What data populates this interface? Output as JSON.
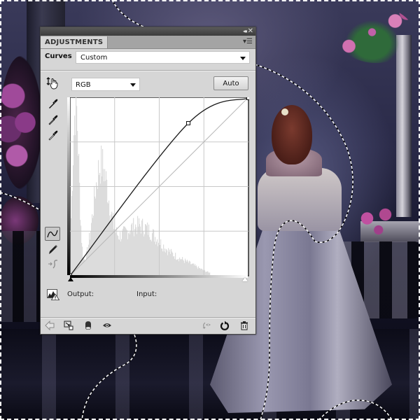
{
  "panel": {
    "tab_label": "ADJUSTMENTS",
    "collapse_glyph": "◂◂",
    "close_glyph": "✕",
    "menu_glyph": "▾☰",
    "adjustment_name": "Curves",
    "preset_value": "Custom",
    "channel_value": "RGB",
    "auto_label": "Auto",
    "output_label": "Output:",
    "input_label": "Input:"
  },
  "curves": {
    "channel": "RGB",
    "range": [
      0,
      255
    ],
    "grid_divisions": 4,
    "control_points": [
      [
        0,
        0
      ],
      [
        169,
        218
      ],
      [
        255,
        254
      ]
    ],
    "baseline": [
      [
        0,
        0
      ],
      [
        255,
        255
      ]
    ],
    "histogram_note": "dark-weighted luminance histogram"
  },
  "side_tools": [
    {
      "name": "on-image-adjust-icon"
    },
    {
      "name": "black-point-eyedropper-icon"
    },
    {
      "name": "gray-point-eyedropper-icon"
    },
    {
      "name": "white-point-eyedropper-icon"
    },
    {
      "name": "curve-edit-tool-icon",
      "active": true
    },
    {
      "name": "pencil-draw-icon"
    },
    {
      "name": "smooth-curve-icon",
      "disabled": true
    }
  ],
  "bottom_tools": [
    {
      "name": "back-arrow-icon"
    },
    {
      "name": "clip-to-layer-icon"
    },
    {
      "name": "layer-mask-icon"
    },
    {
      "name": "visibility-eye-icon"
    },
    {
      "name": "view-previous-state-icon"
    },
    {
      "name": "reset-icon"
    },
    {
      "name": "delete-trash-icon"
    }
  ],
  "colors": {
    "panel_bg": "#d6d6d6",
    "tabbar_bg": "#a4a4a4",
    "titlebar_bg": "#3c3c3c",
    "curve_stroke": "#1a1a1a",
    "histogram_fill": "#dcdcdc",
    "grid_line": "#c8c8c8",
    "selection_ants": "#ffffff"
  }
}
